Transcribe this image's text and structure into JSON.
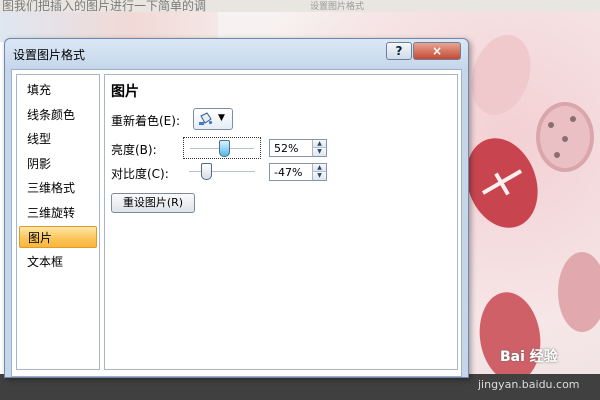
{
  "background": {
    "caption": "图我们把插入的图片进行一下简单的调",
    "caption2": "设置图片格式"
  },
  "watermark": {
    "logo": "Bai 经验",
    "url": "jingyan.baidu.com"
  },
  "dialog": {
    "title": "设置图片格式",
    "help_label": "?",
    "close_label": "×",
    "nav": [
      {
        "label": "填充"
      },
      {
        "label": "线条颜色"
      },
      {
        "label": "线型"
      },
      {
        "label": "阴影"
      },
      {
        "label": "三维格式"
      },
      {
        "label": "三维旋转"
      },
      {
        "label": "图片",
        "selected": true
      },
      {
        "label": "文本框"
      }
    ],
    "section_title": "图片",
    "recolor_label": "重新着色(E):",
    "brightness": {
      "label": "亮度(B):",
      "value": "52%",
      "level": 0.52
    },
    "contrast": {
      "label": "对比度(C):",
      "value": "-47%",
      "level": 0.265
    },
    "reset_button": "重设图片(R)"
  },
  "colors": {
    "nav_selected": "#fbc65b",
    "dialog_frame": "#c5d6ea",
    "close_button": "#c24a33"
  }
}
